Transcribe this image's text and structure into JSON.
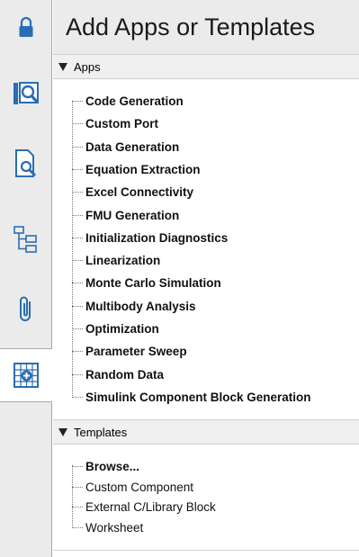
{
  "header": {
    "title": "Add Apps or Templates"
  },
  "toolstrip": {
    "buttons": [
      {
        "icon": "lock-icon",
        "active": false
      },
      {
        "icon": "search-panel-icon",
        "active": false
      },
      {
        "icon": "document-search-icon",
        "active": false
      },
      {
        "icon": "tree-hierarchy-icon",
        "active": false
      },
      {
        "icon": "paperclip-icon",
        "active": false
      },
      {
        "icon": "add-apps-grid-icon",
        "active": true
      }
    ]
  },
  "apps": {
    "label": "Apps",
    "items": [
      "Code Generation",
      "Custom Port",
      "Data Generation",
      "Equation Extraction",
      "Excel Connectivity",
      "FMU Generation",
      "Initialization Diagnostics",
      "Linearization",
      "Monte Carlo Simulation",
      "Multibody Analysis",
      "Optimization",
      "Parameter Sweep",
      "Random Data",
      "Simulink Component Block Generation"
    ]
  },
  "templates": {
    "label": "Templates",
    "items": [
      {
        "label": "Browse...",
        "bold": true
      },
      {
        "label": "Custom Component",
        "bold": false
      },
      {
        "label": "External C/Library Block",
        "bold": false
      },
      {
        "label": "Worksheet",
        "bold": false
      }
    ]
  }
}
